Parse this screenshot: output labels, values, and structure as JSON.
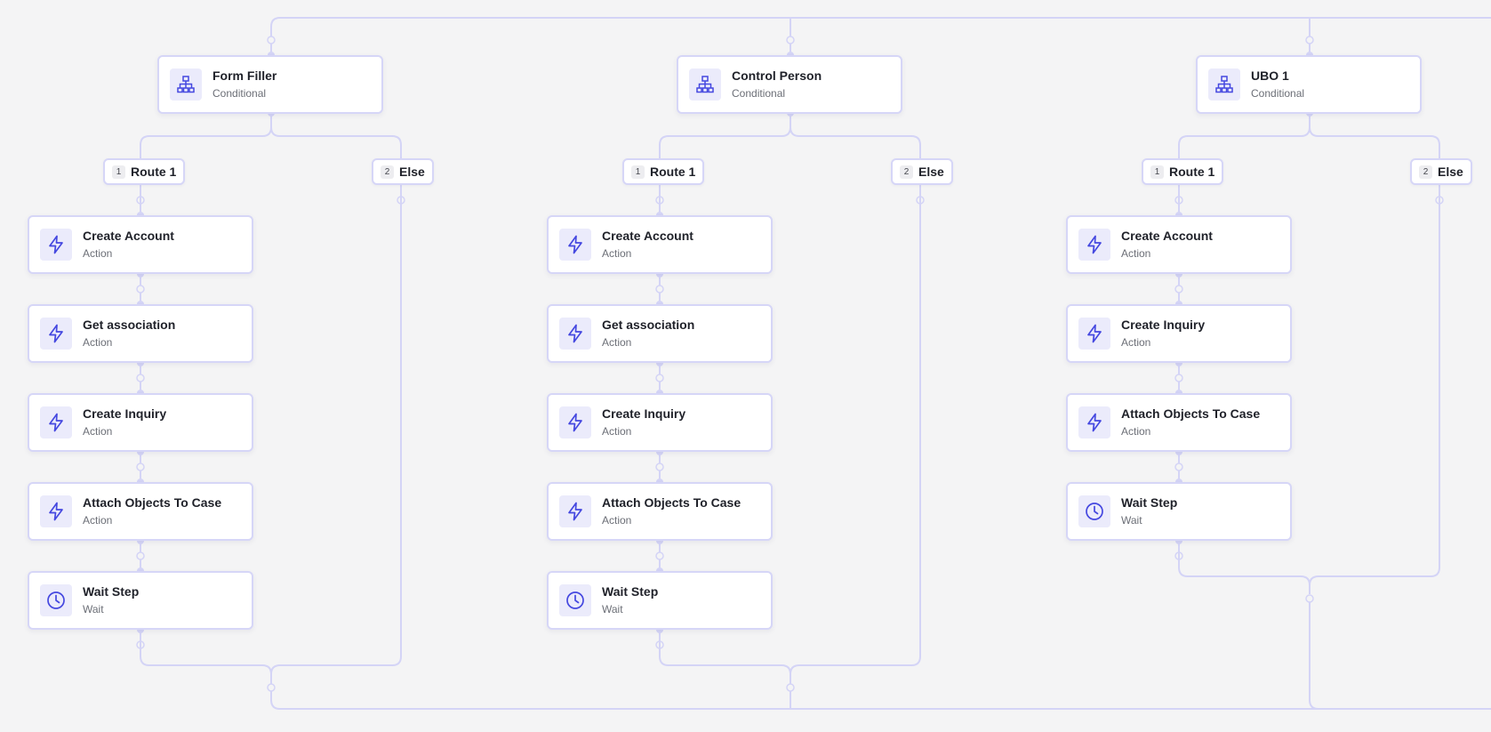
{
  "colors": {
    "edge": "#d4d4f6",
    "accent": "#4548e0",
    "icon_bg": "#ebebfb",
    "canvas": "#f4f4f5"
  },
  "branches": [
    {
      "conditional": {
        "title": "Form Filler",
        "subtitle": "Conditional",
        "icon": "sitemap-icon"
      },
      "routes": [
        {
          "number": "1",
          "label": "Route 1"
        },
        {
          "number": "2",
          "label": "Else"
        }
      ],
      "steps": [
        {
          "title": "Create Account",
          "subtitle": "Action",
          "icon": "lightning-icon"
        },
        {
          "title": "Get association",
          "subtitle": "Action",
          "icon": "lightning-icon"
        },
        {
          "title": "Create Inquiry",
          "subtitle": "Action",
          "icon": "lightning-icon"
        },
        {
          "title": "Attach Objects To Case",
          "subtitle": "Action",
          "icon": "lightning-icon"
        },
        {
          "title": "Wait Step",
          "subtitle": "Wait",
          "icon": "clock-icon"
        }
      ]
    },
    {
      "conditional": {
        "title": "Control Person",
        "subtitle": "Conditional",
        "icon": "sitemap-icon"
      },
      "routes": [
        {
          "number": "1",
          "label": "Route 1"
        },
        {
          "number": "2",
          "label": "Else"
        }
      ],
      "steps": [
        {
          "title": "Create Account",
          "subtitle": "Action",
          "icon": "lightning-icon"
        },
        {
          "title": "Get association",
          "subtitle": "Action",
          "icon": "lightning-icon"
        },
        {
          "title": "Create Inquiry",
          "subtitle": "Action",
          "icon": "lightning-icon"
        },
        {
          "title": "Attach Objects To Case",
          "subtitle": "Action",
          "icon": "lightning-icon"
        },
        {
          "title": "Wait Step",
          "subtitle": "Wait",
          "icon": "clock-icon"
        }
      ]
    },
    {
      "conditional": {
        "title": "UBO 1",
        "subtitle": "Conditional",
        "icon": "sitemap-icon"
      },
      "routes": [
        {
          "number": "1",
          "label": "Route 1"
        },
        {
          "number": "2",
          "label": "Else"
        }
      ],
      "steps": [
        {
          "title": "Create Account",
          "subtitle": "Action",
          "icon": "lightning-icon"
        },
        {
          "title": "Create Inquiry",
          "subtitle": "Action",
          "icon": "lightning-icon"
        },
        {
          "title": "Attach Objects To Case",
          "subtitle": "Action",
          "icon": "lightning-icon"
        },
        {
          "title": "Wait Step",
          "subtitle": "Wait",
          "icon": "clock-icon"
        }
      ]
    }
  ]
}
